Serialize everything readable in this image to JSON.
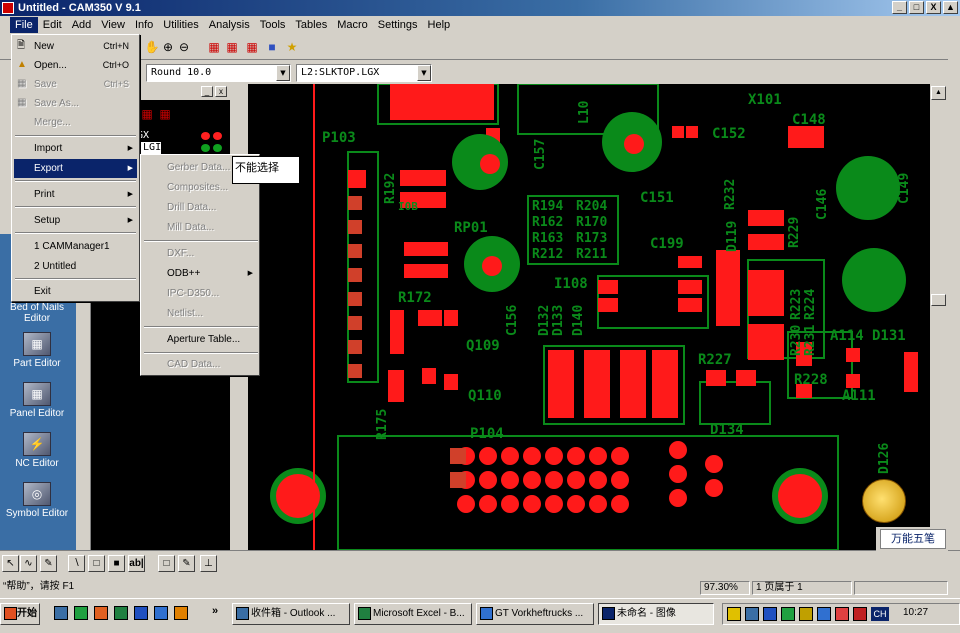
{
  "window": {
    "title": "Untitled - CAM350 V 9.1",
    "controls": [
      "_",
      "□",
      "X",
      "▲"
    ]
  },
  "menubar": [
    "File",
    "Edit",
    "Add",
    "View",
    "Info",
    "Utilities",
    "Analysis",
    "Tools",
    "Tables",
    "Macro",
    "Settings",
    "Help"
  ],
  "toolbar2": {
    "aperture_combo": "Round 10.0",
    "layer_combo": "L2:SLKTOP.LGX"
  },
  "layer_panel": {
    "layers": [
      "LGX",
      "P.LGI"
    ]
  },
  "file_menu": {
    "items": [
      {
        "label": "New",
        "shortcut": "Ctrl+N",
        "enabled": true,
        "icon": "new-file-icon"
      },
      {
        "label": "Open...",
        "shortcut": "Ctrl+O",
        "enabled": true,
        "icon": "open-folder-icon"
      },
      {
        "label": "Save",
        "shortcut": "Ctrl+S",
        "enabled": false,
        "icon": "save-disk-icon"
      },
      {
        "label": "Save As...",
        "shortcut": "",
        "enabled": false,
        "icon": "save-as-icon"
      },
      {
        "label": "Merge...",
        "shortcut": "",
        "enabled": false,
        "icon": ""
      },
      {
        "label": "Import",
        "shortcut": "",
        "enabled": true,
        "submenu": true
      },
      {
        "label": "Export",
        "shortcut": "",
        "enabled": true,
        "submenu": true,
        "highlighted": true
      },
      {
        "label": "Print",
        "shortcut": "",
        "enabled": true,
        "submenu": true
      },
      {
        "label": "Setup",
        "shortcut": "",
        "enabled": true,
        "submenu": true
      },
      {
        "label": "1 CAMManager1",
        "shortcut": "",
        "enabled": true
      },
      {
        "label": "2 Untitled",
        "shortcut": "",
        "enabled": true
      },
      {
        "label": "Exit",
        "shortcut": "",
        "enabled": true
      }
    ]
  },
  "export_menu": {
    "items": [
      {
        "label": "Gerber Data...",
        "enabled": false
      },
      {
        "label": "Composites...",
        "enabled": false
      },
      {
        "label": "Drill Data...",
        "enabled": false
      },
      {
        "label": "Mill Data...",
        "enabled": false
      },
      {
        "label": "DXF...",
        "enabled": false
      },
      {
        "label": "ODB++",
        "enabled": true,
        "submenu": true
      },
      {
        "label": "IPC-D350...",
        "enabled": false
      },
      {
        "label": "Netlist...",
        "enabled": false
      },
      {
        "label": "Aperture Table...",
        "enabled": true
      },
      {
        "label": "CAD Data...",
        "enabled": false
      }
    ]
  },
  "tooltip": "不能选择",
  "left_tools": [
    "Bed of Nails Editor",
    "Part Editor",
    "Panel Editor",
    "NC Editor",
    "Symbol Editor"
  ],
  "pcb_labels": {
    "x101": "X101",
    "c148": "C148",
    "c152": "C152",
    "p103": "P103",
    "c157": "C157",
    "c151": "C151",
    "r232": "R232",
    "r229": "R229",
    "c146": "C146",
    "c149": "C149",
    "r194": "R194",
    "r204": "R204",
    "r162": "R162",
    "r170": "R170",
    "r163": "R163",
    "r173": "R173",
    "r212": "R212",
    "r211": "R211",
    "rp01": "RP01",
    "c199": "C199",
    "d119": "D119",
    "r223": "R223",
    "r224": "R224",
    "r172": "R172",
    "i108": "I108",
    "c156": "C156",
    "d132": "D132",
    "d133": "D133",
    "d140": "D140",
    "q109": "Q109",
    "r175": "R175",
    "q110": "Q110",
    "r227": "R227",
    "r228": "R228",
    "a111": "A111",
    "d134": "D134",
    "p104": "P104",
    "a114": "A114",
    "d131": "D131",
    "r230": "R230",
    "r231": "R231",
    "d126": "D126",
    "l10": "L10",
    "r192": "R192",
    "i0b": "I0B"
  },
  "status": {
    "help": "“帮助”，请按 F1",
    "zoom": "97.30%",
    "page": "1 页属于 1"
  },
  "taskbar": {
    "start": "开始",
    "tasks": [
      "收件箱 - Outlook ...",
      "Microsoft Excel - B...",
      "GT Vorkheftrucks ...",
      "未命名 - 图像"
    ],
    "clock": "10:27",
    "ime": "万能五笔",
    "lang": "CH"
  },
  "colors": {
    "pcb_green": "#0a8a1a",
    "pcb_red": "#ff1a1a",
    "selection": "#0a246a"
  }
}
